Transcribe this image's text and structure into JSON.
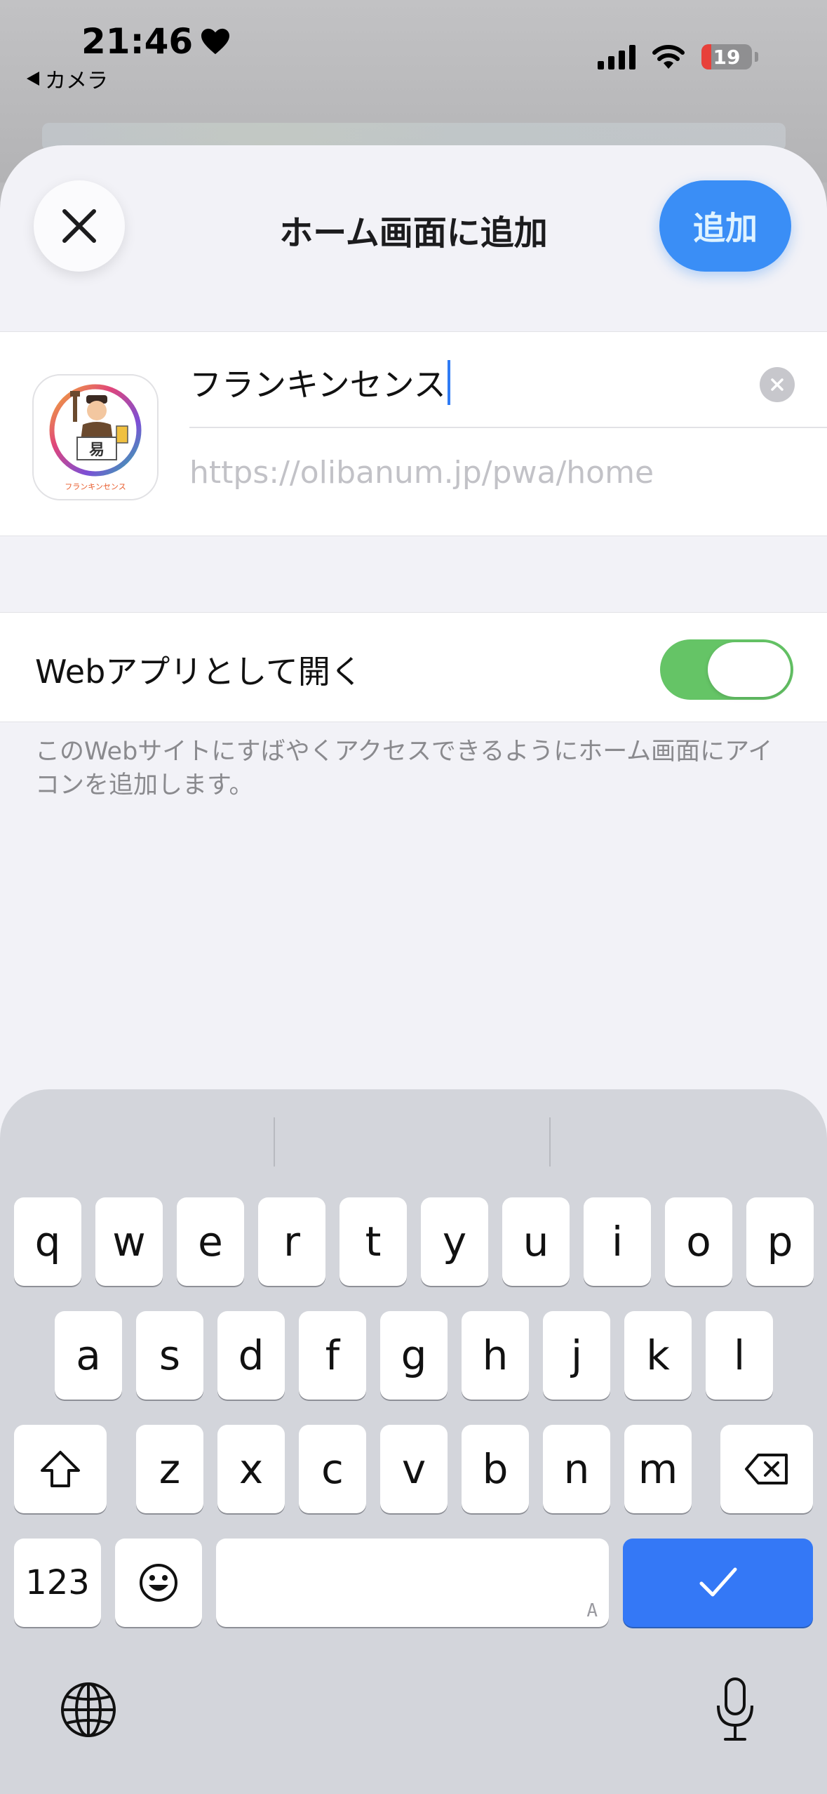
{
  "status_bar": {
    "time": "21:46",
    "back_label": "カメラ",
    "battery_level": "19"
  },
  "sheet": {
    "title": "ホーム画面に追加",
    "add_label": "追加",
    "name_value": "フランキンセンス",
    "url": "https://olibanum.jp/pwa/home",
    "icon_caption": "フランキンセンス",
    "webapp_label": "Webアプリとして開く",
    "webapp_enabled": true,
    "footnote": "このWebサイトにすばやくアクセスできるようにホーム画面にアイコンを追加します。"
  },
  "keyboard": {
    "row1": [
      "q",
      "w",
      "e",
      "r",
      "t",
      "y",
      "u",
      "i",
      "o",
      "p"
    ],
    "row2": [
      "a",
      "s",
      "d",
      "f",
      "g",
      "h",
      "j",
      "k",
      "l"
    ],
    "row3": [
      "z",
      "x",
      "c",
      "v",
      "b",
      "n",
      "m"
    ],
    "numbers_label": "123",
    "space_mark": "A"
  },
  "colors": {
    "accent": "#3a8ef6",
    "toggle_on": "#65c466",
    "caret": "#2f7bf5"
  }
}
